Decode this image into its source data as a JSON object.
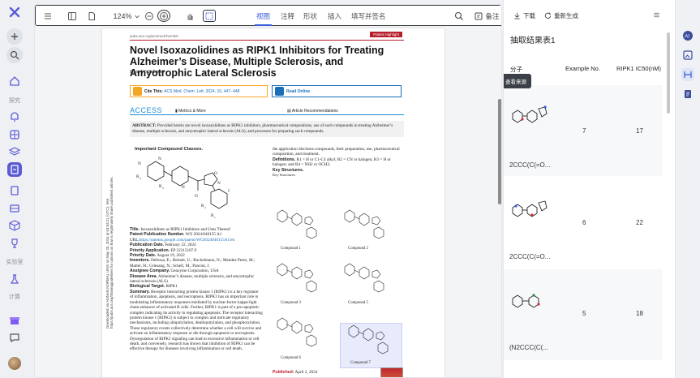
{
  "rail": {
    "sections": [
      "探究",
      "实验室",
      "计算"
    ]
  },
  "toolbar": {
    "zoom": "124%",
    "tabs": [
      "视图",
      "注释",
      "形状",
      "插入",
      "填写并签名"
    ],
    "selected_tab": "视图",
    "note_label": "备注"
  },
  "paper": {
    "url": "pubs.acs.org/acsmedchemlett",
    "badge": "Patent Highlight",
    "title": "Novel Isoxazolidines as RIPK1 Inhibitors for Treating Alzheimer’s Disease, Multiple Sclerosis, and Amyotrophic Lateral Sclerosis",
    "author": "Ram W. Sabnis*",
    "cite_label": "Cite This:",
    "cite_ref": "ACS Med. Chem. Lett. 2024, 15, 447−448",
    "read_online": "Read Online",
    "access": "ACCESS",
    "metrics": "Metrics & More",
    "recommendations": "Article Recommendations",
    "abstract_label": "ABSTRACT:",
    "abstract": "Provided herein are novel isoxazolidines as RIPK1 inhibitors, pharmaceutical compositions, use of such compounds in treating Alzheimer’s disease, multiple sclerosis, and amyotrophic lateral sclerosis (ALS), and processes for preparing such compounds.",
    "side_note": "Downloaded via HUNAN NORMAL UNIV on May 20, 2024 at 04:54:21 (UTC). See https://pubs.acs.org/sharingguidelines for options on how to legitimately share published articles.",
    "fig_title": "Important Compound Classes.",
    "left_body": [
      {
        "k": "Title.",
        "v": "Isoxazolidines as RIPK1 Inhibitors and Uses Thereof"
      },
      {
        "k": "Patent Publication Number.",
        "v": "WO 2024/040155 A1"
      },
      {
        "k": "URL:",
        "v": "https://patents.google.com/patent/WO2024040155A1/en"
      },
      {
        "k": "Publication Date.",
        "v": "February 22, 2024"
      },
      {
        "k": "Priority Application.",
        "v": "EP 22315187.9"
      },
      {
        "k": "Priority Date.",
        "v": "August 19, 2022"
      },
      {
        "k": "Inventors.",
        "v": "Defossa, E.; Heinelt, U.; Ruckelmann, N.; Mendez Perez, M.; Matter, H.; Griesang, N.; Schell, M.; Pancini, J."
      },
      {
        "k": "Assignee Company.",
        "v": "Genzyme Corporation, USA"
      },
      {
        "k": "Disease Area.",
        "v": "Alzheimer’s disease, multiple sclerosis, and amyotrophic lateral sclerosis (ALS)"
      },
      {
        "k": "Biological Target.",
        "v": "RIPK1"
      },
      {
        "k": "Summary.",
        "v": "Receptor interacting protein kinase 1 (RIPK1) is a key regulator of inflammation, apoptosis, and necroptosis. RIPK1 has an important role in modulating inflammatory responses mediated by nuclear-factor kappa-light chain enhancer of activated B cells. Further, RIPK1 is part of a pro-apoptotic complex indicating its activity in regulating apoptosis. The receptor interacting protein kinase 1 (RIPK1) is subject to complex and intricate regulatory mechanisms, including ubiquitylation, deubiquitylation, and phosphorylation. These regulatory events collectively determine whether a cell will survive and activate an inflammatory response or die through apoptosis or necroptosis. Dysregulation of RIPK1 signaling can lead to excessive inflammation or cell death, and conversely, research has shown that inhibition of RIPK1 can be effective therapy for diseases involving inflammation or cell death."
      }
    ],
    "right_intro": "the application discloses compounds, their preparation, use, pharmaceutical composition, and treatment.",
    "definitions_k": "Definitions.",
    "definitions_v": "R1 = H or C1-C4 alkyl; R2 = CN or halogen; R3 = H or halogen; and R4 = NH2 or OCH3.",
    "key_structures": "Key Structures.",
    "key_structures_label": "Key Structures:",
    "compounds": [
      "Compound 1",
      "Compound 2",
      "Compound 3",
      "Compound 5",
      "Compound 6",
      "Compound 7"
    ],
    "published_label": "Published:",
    "published_date": "April 2, 2024"
  },
  "right_panel": {
    "download": "下载",
    "regenerate": "重新生成",
    "title": "抽取结果表1",
    "columns": [
      "分子",
      "Example No.",
      "RIPK1 IC50(nM)"
    ],
    "tooltip": "查看来源",
    "rows": [
      {
        "smiles": "2CCC(C(=O...",
        "example": "7",
        "ic50": "17"
      },
      {
        "smiles": "2CCC(C(=O...",
        "example": "6",
        "ic50": "22"
      },
      {
        "smiles": "(N2CCC(C(...",
        "example": "5",
        "ic50": "18"
      }
    ]
  },
  "colors": {
    "accent": "#3b5bdb",
    "rail_active": "#5b5bd6",
    "acs_red": "#b81d2a",
    "acs_blue": "#1b8dd6"
  }
}
